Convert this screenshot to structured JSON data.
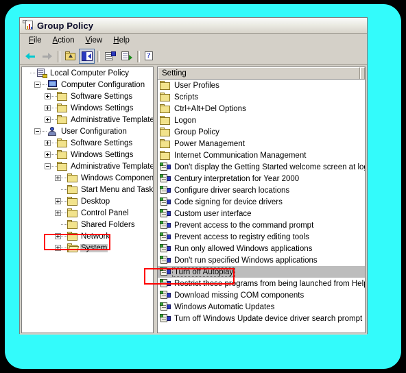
{
  "window": {
    "title": "Group Policy",
    "title_icon": "group-policy-icon"
  },
  "menubar": {
    "items": [
      {
        "label": "File",
        "accel": "F"
      },
      {
        "label": "Action",
        "accel": "A"
      },
      {
        "label": "View",
        "accel": "V"
      },
      {
        "label": "Help",
        "accel": "H"
      }
    ]
  },
  "toolbar": {
    "buttons": [
      {
        "name": "back-button",
        "icon": "back-arrow-icon",
        "state": "enabled"
      },
      {
        "name": "forward-button",
        "icon": "forward-arrow-icon",
        "state": "disabled"
      },
      {
        "name": "up-one-level-button",
        "icon": "up-folder-icon",
        "state": "enabled"
      },
      {
        "name": "show-hide-tree-button",
        "icon": "console-tree-icon",
        "state": "pressed"
      },
      {
        "name": "properties-button",
        "icon": "properties-icon",
        "state": "enabled"
      },
      {
        "name": "export-list-button",
        "icon": "export-list-icon",
        "state": "enabled"
      },
      {
        "name": "help-button",
        "icon": "help-icon",
        "state": "enabled"
      }
    ]
  },
  "tree": {
    "nodes": [
      {
        "label": "Local Computer Policy",
        "indent": 0,
        "expander": "none",
        "icon": "console-root-icon",
        "selected": false
      },
      {
        "label": "Computer Configuration",
        "indent": 1,
        "expander": "minus",
        "icon": "computer-icon",
        "selected": false
      },
      {
        "label": "Software Settings",
        "indent": 2,
        "expander": "plus",
        "icon": "folder-icon",
        "selected": false
      },
      {
        "label": "Windows Settings",
        "indent": 2,
        "expander": "plus",
        "icon": "folder-icon",
        "selected": false
      },
      {
        "label": "Administrative Templates",
        "indent": 2,
        "expander": "plus",
        "icon": "folder-icon",
        "selected": false
      },
      {
        "label": "User Configuration",
        "indent": 1,
        "expander": "minus",
        "icon": "user-icon",
        "selected": false
      },
      {
        "label": "Software Settings",
        "indent": 2,
        "expander": "plus",
        "icon": "folder-icon",
        "selected": false
      },
      {
        "label": "Windows Settings",
        "indent": 2,
        "expander": "plus",
        "icon": "folder-icon",
        "selected": false
      },
      {
        "label": "Administrative Templates",
        "indent": 2,
        "expander": "minus",
        "icon": "folder-icon",
        "selected": false
      },
      {
        "label": "Windows Components",
        "indent": 3,
        "expander": "plus",
        "icon": "folder-icon",
        "selected": false
      },
      {
        "label": "Start Menu and Taskbar",
        "indent": 3,
        "expander": "none",
        "icon": "folder-icon",
        "selected": false
      },
      {
        "label": "Desktop",
        "indent": 3,
        "expander": "plus",
        "icon": "folder-icon",
        "selected": false
      },
      {
        "label": "Control Panel",
        "indent": 3,
        "expander": "plus",
        "icon": "folder-icon",
        "selected": false
      },
      {
        "label": "Shared Folders",
        "indent": 3,
        "expander": "none",
        "icon": "folder-icon",
        "selected": false
      },
      {
        "label": "Network",
        "indent": 3,
        "expander": "plus",
        "icon": "folder-icon",
        "selected": false
      },
      {
        "label": "System",
        "indent": 3,
        "expander": "plus",
        "icon": "folder-open-icon",
        "selected": true
      }
    ]
  },
  "list": {
    "column_header": "Setting",
    "rows": [
      {
        "label": "User Profiles",
        "icon": "folder-icon",
        "selected": false
      },
      {
        "label": "Scripts",
        "icon": "folder-icon",
        "selected": false
      },
      {
        "label": "Ctrl+Alt+Del Options",
        "icon": "folder-icon",
        "selected": false
      },
      {
        "label": "Logon",
        "icon": "folder-icon",
        "selected": false
      },
      {
        "label": "Group Policy",
        "icon": "folder-icon",
        "selected": false
      },
      {
        "label": "Power Management",
        "icon": "folder-icon",
        "selected": false
      },
      {
        "label": "Internet Communication Management",
        "icon": "folder-icon",
        "selected": false
      },
      {
        "label": "Don't display the Getting Started welcome screen at logon",
        "icon": "policy-icon",
        "selected": false
      },
      {
        "label": "Century interpretation for Year 2000",
        "icon": "policy-icon",
        "selected": false
      },
      {
        "label": "Configure driver search locations",
        "icon": "policy-icon",
        "selected": false
      },
      {
        "label": "Code signing for device drivers",
        "icon": "policy-icon",
        "selected": false
      },
      {
        "label": "Custom user interface",
        "icon": "policy-icon",
        "selected": false
      },
      {
        "label": "Prevent access to the command prompt",
        "icon": "policy-icon",
        "selected": false
      },
      {
        "label": "Prevent access to registry editing tools",
        "icon": "policy-icon",
        "selected": false
      },
      {
        "label": "Run only allowed Windows applications",
        "icon": "policy-icon",
        "selected": false
      },
      {
        "label": "Don't run specified Windows applications",
        "icon": "policy-icon",
        "selected": false
      },
      {
        "label": "Turn off Autoplay",
        "icon": "policy-icon",
        "selected": true
      },
      {
        "label": "Restrict these programs from being launched from Help",
        "icon": "policy-icon",
        "selected": false
      },
      {
        "label": "Download missing COM components",
        "icon": "policy-icon",
        "selected": false
      },
      {
        "label": "Windows Automatic Updates",
        "icon": "policy-icon",
        "selected": false
      },
      {
        "label": "Turn off Windows Update device driver search prompt",
        "icon": "policy-icon",
        "selected": false
      }
    ]
  },
  "annotations": {
    "color": "#FF0000",
    "boxes": [
      {
        "name": "annotation-system-node",
        "target": "System"
      },
      {
        "name": "annotation-turn-off-autoplay",
        "target": "Turn off Autoplay"
      }
    ]
  },
  "colors": {
    "backdrop": "#33FBFB",
    "window_face": "#D4D0C8",
    "selection": "#BDBDBD",
    "annotation": "#FF0000"
  }
}
